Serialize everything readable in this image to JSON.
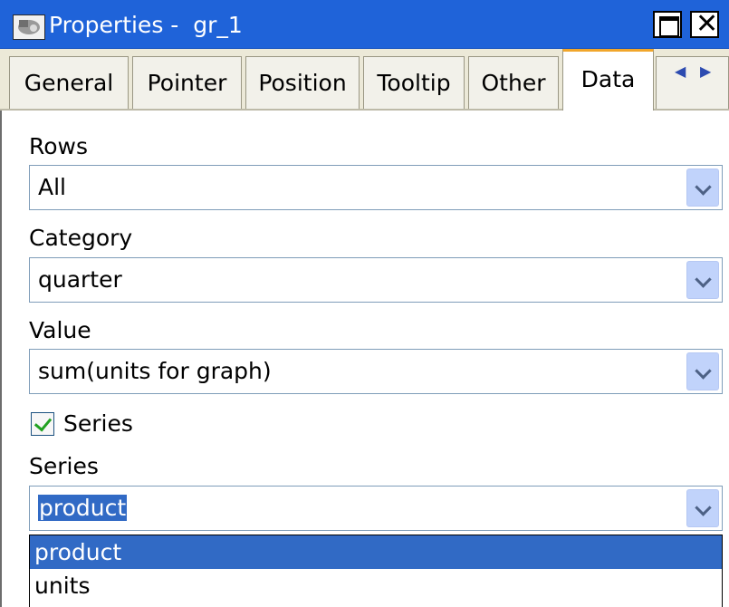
{
  "window": {
    "title": "Properties -  gr_1",
    "app_icon": "properties-window-icon",
    "maximize_icon": "maximize-icon",
    "close_icon": "close-icon",
    "close_glyph": "✕"
  },
  "tabs": [
    {
      "label": "General",
      "active": false
    },
    {
      "label": "Pointer",
      "active": false
    },
    {
      "label": "Position",
      "active": false
    },
    {
      "label": "Tooltip",
      "active": false
    },
    {
      "label": "Other",
      "active": false
    },
    {
      "label": "Data",
      "active": true
    }
  ],
  "tab_scroll": {
    "left_icon": "scroll-left-arrow-icon",
    "right_icon": "scroll-right-arrow-icon"
  },
  "fields": {
    "rows": {
      "label": "Rows",
      "value": "All"
    },
    "category": {
      "label": "Category",
      "value": "quarter"
    },
    "value": {
      "label": "Value",
      "value": "sum(units for graph)"
    },
    "series_checkbox": {
      "label": "Series",
      "checked": true
    },
    "series": {
      "label": "Series",
      "value": "product"
    }
  },
  "series_dropdown": {
    "options": [
      "product",
      "units"
    ],
    "selected": "product"
  },
  "colors": {
    "titlebar": "#1f63d9",
    "selection": "#316ac5",
    "active_tab_accent": "#f1a62b"
  }
}
